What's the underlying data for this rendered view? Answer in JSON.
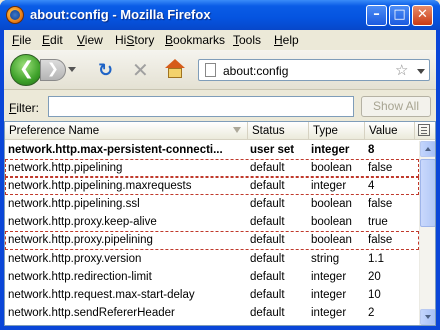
{
  "window": {
    "title": "about:config - Mozilla Firefox",
    "minimize": "–",
    "maximize": "□",
    "close": "✕"
  },
  "menubar": {
    "items": [
      {
        "key": "F",
        "rest": "ile"
      },
      {
        "key": "E",
        "rest": "dit"
      },
      {
        "key": "V",
        "rest": "iew"
      },
      {
        "key": "S",
        "pre": "Hi",
        "rest": "tory"
      },
      {
        "key": "B",
        "rest": "ookmarks"
      },
      {
        "key": "T",
        "rest": "ools"
      },
      {
        "key": "H",
        "rest": "elp"
      }
    ]
  },
  "navbar": {
    "url": "about:config"
  },
  "filter": {
    "label": "Filter:",
    "value": "",
    "show_all": "Show All"
  },
  "table": {
    "columns": {
      "name": "Preference Name",
      "status": "Status",
      "type": "Type",
      "value": "Value"
    },
    "rows": [
      {
        "name": "network.http.max-persistent-connecti...",
        "status": "user set",
        "type": "integer",
        "value": "8"
      },
      {
        "name": "network.http.pipelining",
        "status": "default",
        "type": "boolean",
        "value": "false"
      },
      {
        "name": "network.http.pipelining.maxrequests",
        "status": "default",
        "type": "integer",
        "value": "4"
      },
      {
        "name": "network.http.pipelining.ssl",
        "status": "default",
        "type": "boolean",
        "value": "false"
      },
      {
        "name": "network.http.proxy.keep-alive",
        "status": "default",
        "type": "boolean",
        "value": "true"
      },
      {
        "name": "network.http.proxy.pipelining",
        "status": "default",
        "type": "boolean",
        "value": "false"
      },
      {
        "name": "network.http.proxy.version",
        "status": "default",
        "type": "string",
        "value": "1.1"
      },
      {
        "name": "network.http.redirection-limit",
        "status": "default",
        "type": "integer",
        "value": "20"
      },
      {
        "name": "network.http.request.max-start-delay",
        "status": "default",
        "type": "integer",
        "value": "10"
      },
      {
        "name": "network.http.sendRefererHeader",
        "status": "default",
        "type": "integer",
        "value": "2"
      }
    ]
  }
}
